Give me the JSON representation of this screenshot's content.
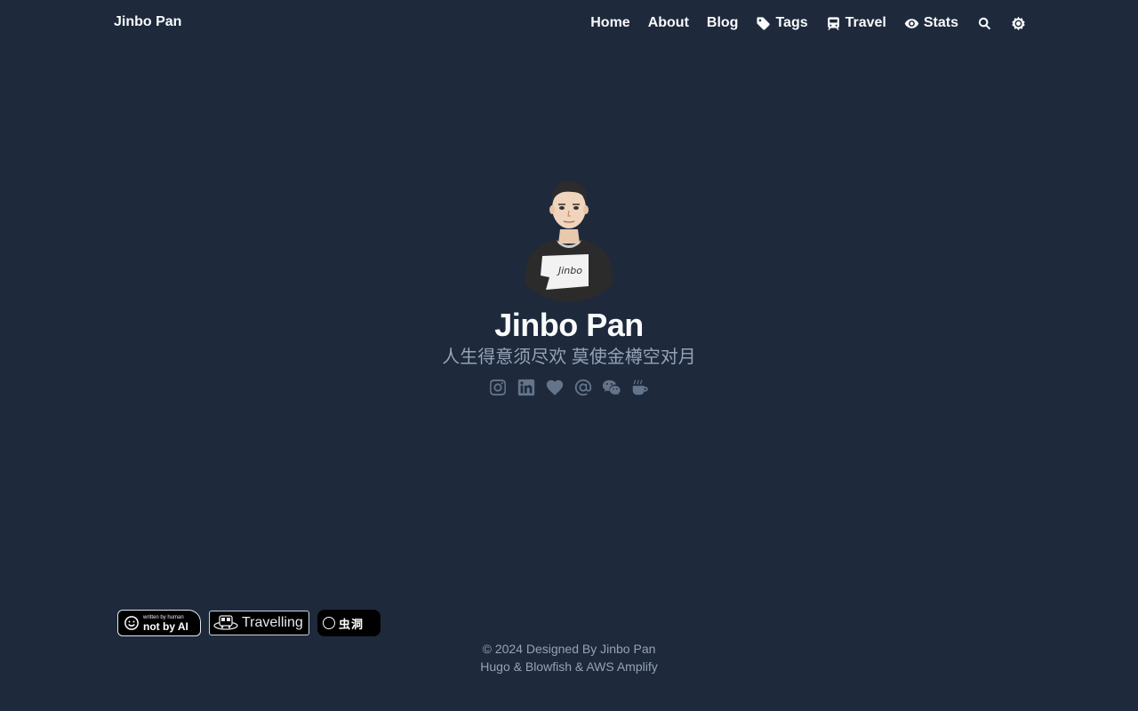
{
  "header": {
    "brand": "Jinbo Pan",
    "nav": [
      {
        "label": "Home",
        "icon": null
      },
      {
        "label": "About",
        "icon": null
      },
      {
        "label": "Blog",
        "icon": null
      },
      {
        "label": "Tags",
        "icon": "tag-icon"
      },
      {
        "label": "Travel",
        "icon": "train-icon"
      },
      {
        "label": "Stats",
        "icon": "eye-icon"
      }
    ],
    "search_icon": "search-icon",
    "theme_icon": "sun-icon"
  },
  "hero": {
    "name": "Jinbo Pan",
    "motto": "人生得意须尽欢 莫使金樽空对月",
    "avatar_shirt_text": "Jinbo",
    "socials": [
      "instagram-icon",
      "linkedin-icon",
      "heart-icon",
      "at-icon",
      "wechat-icon",
      "coffee-icon"
    ]
  },
  "footer": {
    "badges": {
      "not_by_ai": {
        "small": "written by human",
        "big": "not by AI"
      },
      "travelling": {
        "label": "Travelling"
      },
      "wormhole": {
        "label": "虫洞"
      }
    },
    "copyright_line1": "© 2024 Designed By Jinbo Pan",
    "copyright_line2": "Hugo & Blowfish & AWS Amplify"
  },
  "colors": {
    "background": "#1e293b",
    "text": "#f8fafc",
    "muted": "#94a3b8",
    "icon_muted": "#64748b"
  }
}
